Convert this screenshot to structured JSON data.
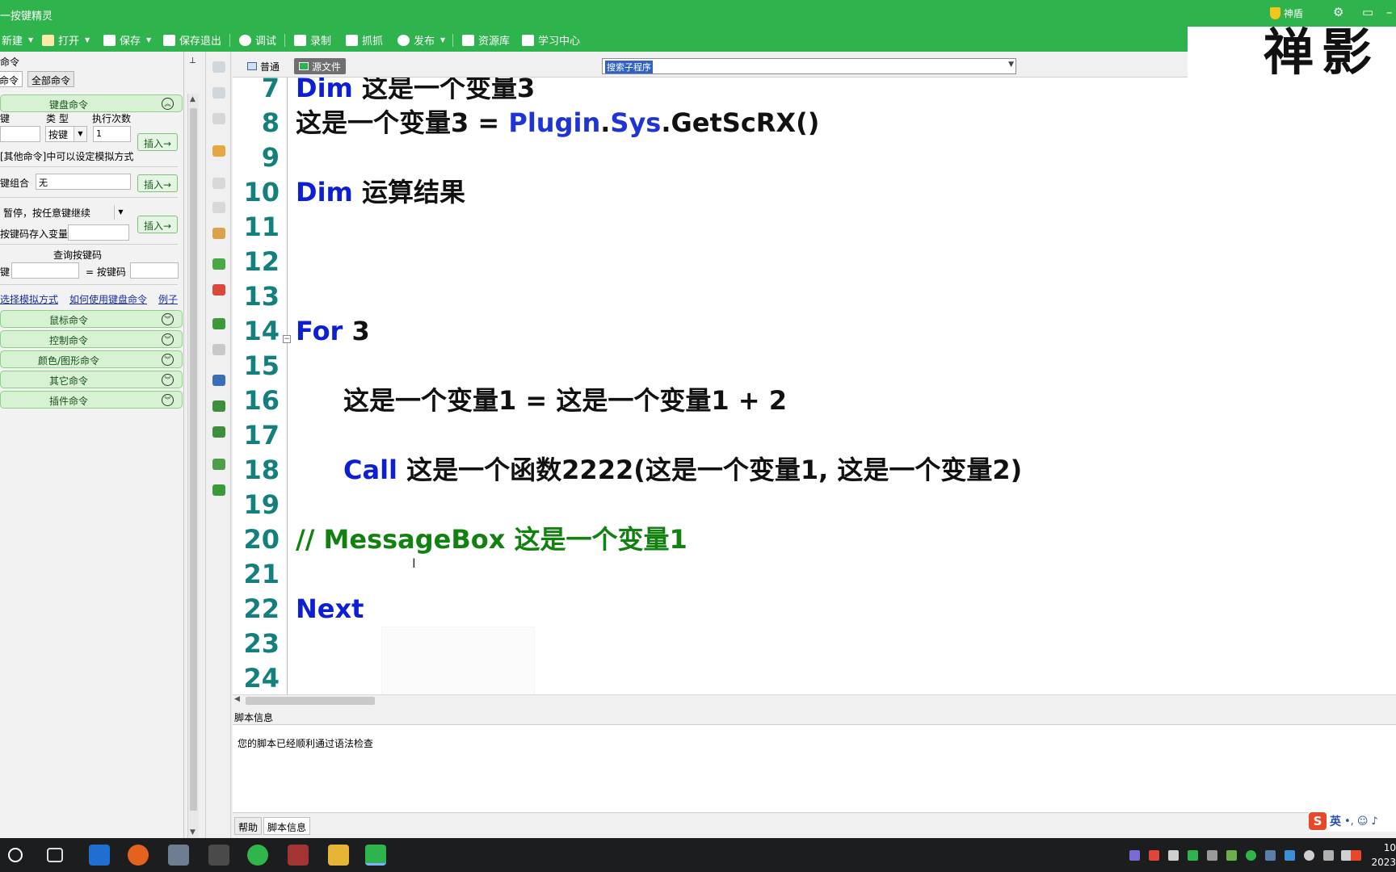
{
  "window": {
    "title": "一按键精灵",
    "shield_label": "神盾",
    "settings_glyph": "⚙",
    "restore_glyph": "▭",
    "minimize_glyph": "–"
  },
  "toolbar": {
    "new": "新建",
    "open": "打开",
    "save": "保存",
    "save_exit": "保存退出",
    "debug": "调试",
    "record": "录制",
    "capture": "抓抓",
    "publish": "发布",
    "resources": "资源库",
    "learning": "学习中心"
  },
  "watermark": "禅影",
  "left_panel": {
    "header": "命令",
    "pin": "📌",
    "tabs": [
      "常用命令",
      "全部命令"
    ],
    "keyboard_section": "键盘命令",
    "col_key": "键",
    "col_type": "类 型",
    "col_count": "执行次数",
    "type_value": "按键",
    "count_value": "1",
    "insert_label": "插入→",
    "hint_simulate": "[其他命令]中可以设定模拟方式",
    "combo_label": "键组合",
    "combo_value": "无",
    "pause_option": "暂停，按任意键继续",
    "save_keycode_label": "按键码存入变量",
    "query_keycode": "查询按键码",
    "key_label": "键",
    "eq_keycode": "= 按键码",
    "link_simulate": "选择模拟方式",
    "link_how": "如何使用键盘命令",
    "link_example": "例子",
    "sections": [
      "鼠标命令",
      "控制命令",
      "颜色/图形命令",
      "其它命令",
      "插件命令"
    ]
  },
  "editor_header": {
    "tab_normal": "普通",
    "tab_source": "源文件",
    "combo_value": "搜索子程序"
  },
  "code": [
    {
      "num": "7",
      "indent": false,
      "parts": [
        {
          "t": "Dim",
          "c": "kw"
        },
        {
          "t": " 这是一个变量3",
          "c": ""
        }
      ]
    },
    {
      "num": "8",
      "indent": false,
      "parts": [
        {
          "t": "这是一个变量3 = ",
          "c": ""
        },
        {
          "t": "Plugin",
          "c": "obj"
        },
        {
          "t": ".",
          "c": ""
        },
        {
          "t": "Sys",
          "c": "obj"
        },
        {
          "t": ".GetScRX()",
          "c": ""
        }
      ]
    },
    {
      "num": "9",
      "indent": false,
      "parts": []
    },
    {
      "num": "10",
      "indent": false,
      "parts": [
        {
          "t": "Dim",
          "c": "kw"
        },
        {
          "t": " 运算结果",
          "c": ""
        }
      ]
    },
    {
      "num": "11",
      "indent": false,
      "parts": []
    },
    {
      "num": "12",
      "indent": false,
      "parts": []
    },
    {
      "num": "13",
      "indent": false,
      "parts": []
    },
    {
      "num": "14",
      "indent": false,
      "parts": [
        {
          "t": "For",
          "c": "kw"
        },
        {
          "t": " 3",
          "c": ""
        }
      ]
    },
    {
      "num": "15",
      "indent": false,
      "parts": []
    },
    {
      "num": "16",
      "indent": true,
      "parts": [
        {
          "t": "这是一个变量1 = 这是一个变量1 + 2",
          "c": ""
        }
      ]
    },
    {
      "num": "17",
      "indent": false,
      "parts": []
    },
    {
      "num": "18",
      "indent": true,
      "parts": [
        {
          "t": "Call",
          "c": "kw"
        },
        {
          "t": " 这是一个函数2222(这是一个变量1, 这是一个变量2)",
          "c": ""
        }
      ]
    },
    {
      "num": "19",
      "indent": false,
      "parts": []
    },
    {
      "num": "20",
      "indent": false,
      "parts": [
        {
          "t": "//   MessageBox 这是一个变量1",
          "c": "cmt"
        }
      ]
    },
    {
      "num": "21",
      "indent": false,
      "parts": []
    },
    {
      "num": "22",
      "indent": false,
      "parts": [
        {
          "t": "Next",
          "c": "kw"
        }
      ]
    },
    {
      "num": "23",
      "indent": false,
      "parts": []
    },
    {
      "num": "24",
      "indent": false,
      "parts": []
    }
  ],
  "info_pane": {
    "title": "脚本信息",
    "message": "您的脚本已经顺利通过语法检查",
    "tab_help": "帮助",
    "tab_info": "脚本信息"
  },
  "ime": {
    "logo": "S",
    "lang": "英",
    "punct": "•,",
    "emoji": "☺"
  },
  "clock": {
    "time": "10",
    "date": "2023"
  },
  "colors": {
    "accent_green": "#2eb34d",
    "keyword_blue": "#0d1fd4",
    "comment_green": "#11820f",
    "line_number_teal": "#14807e"
  }
}
